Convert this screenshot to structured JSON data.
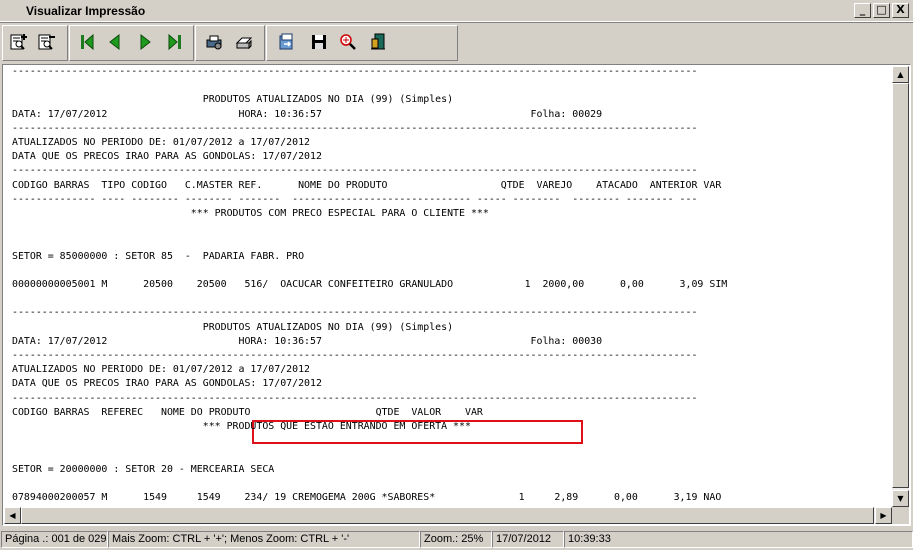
{
  "window": {
    "title": "Visualizar Impressão",
    "controls": {
      "minimize": "_",
      "maximize": "□",
      "close": "X"
    }
  },
  "toolbar": {
    "buttons": [
      {
        "name": "zoom-in-page",
        "icon": "page-zoom-in-icon"
      },
      {
        "name": "zoom-out-page",
        "icon": "page-zoom-out-icon"
      },
      {
        "name": "first-page",
        "icon": "first-page-icon"
      },
      {
        "name": "previous-page",
        "icon": "previous-page-icon"
      },
      {
        "name": "next-page",
        "icon": "next-page-icon"
      },
      {
        "name": "last-page",
        "icon": "last-page-icon"
      },
      {
        "name": "print-setup",
        "icon": "printer-setup-icon"
      },
      {
        "name": "print",
        "icon": "printer-icon"
      },
      {
        "name": "export",
        "icon": "export-icon"
      },
      {
        "name": "save",
        "icon": "floppy-disk-icon"
      },
      {
        "name": "search",
        "icon": "magnifier-icon"
      },
      {
        "name": "exit",
        "icon": "exit-door-icon"
      }
    ]
  },
  "report": {
    "lines": [
      "-------------------------------------------------------------------------------------------------------------------",
      "",
      "                                PRODUTOS ATUALIZADOS NO DIA (99) (Simples)",
      "DATA: 17/07/2012                      HORA: 10:36:57                                   Folha: 00029",
      "-------------------------------------------------------------------------------------------------------------------",
      "ATUALIZADOS NO PERIODO DE: 01/07/2012 a 17/07/2012",
      "DATA QUE OS PRECOS IRAO PARA AS GONDOLAS: 17/07/2012",
      "-------------------------------------------------------------------------------------------------------------------",
      "CODIGO BARRAS  TIPO CODIGO   C.MASTER REF.      NOME DO PRODUTO                   QTDE  VAREJO    ATACADO  ANTERIOR VAR",
      "-------------- ---- -------- -------- -------  ------------------------------ ----- --------  -------- -------- ---",
      "                              *** PRODUTOS COM PRECO ESPECIAL PARA O CLIENTE ***",
      "",
      "",
      "SETOR = 85000000 : SETOR 85  -  PADARIA FABR. PRO",
      "",
      "00000000005001 M      20500    20500   516/  OACUCAR CONFEITEIRO GRANULADO            1  2000,00      0,00      3,09 SIM",
      "",
      "-------------------------------------------------------------------------------------------------------------------",
      "                                PRODUTOS ATUALIZADOS NO DIA (99) (Simples)",
      "DATA: 17/07/2012                      HORA: 10:36:57                                   Folha: 00030",
      "-------------------------------------------------------------------------------------------------------------------",
      "ATUALIZADOS NO PERIODO DE: 01/07/2012 a 17/07/2012",
      "DATA QUE OS PRECOS IRAO PARA AS GONDOLAS: 17/07/2012",
      "-------------------------------------------------------------------------------------------------------------------",
      "CODIGO BARRAS  REFEREC   NOME DO PRODUTO                     QTDE  VALOR    VAR",
      "                                *** PRODUTOS QUE ESTAO ENTRANDO EM OFERTA ***",
      "",
      "",
      "SETOR = 20000000 : SETOR 20 - MERCEARIA SECA",
      "",
      "07894000200057 M      1549     1549    234/ 19 CREMOGEMA 200G *SABORES*              1     2,89      0,00      3,19 NAO"
    ]
  },
  "statusbar": {
    "page": "Página .: 001 de 029",
    "zoom_help": "Mais Zoom: CTRL + '+'; Menos Zoom: CTRL + '-'",
    "zoom": "Zoom.: 25%",
    "date": "17/07/2012",
    "time": "10:39:33"
  },
  "colors": {
    "highlight_box": "#e0101a",
    "chrome": "#d4d0c8"
  }
}
